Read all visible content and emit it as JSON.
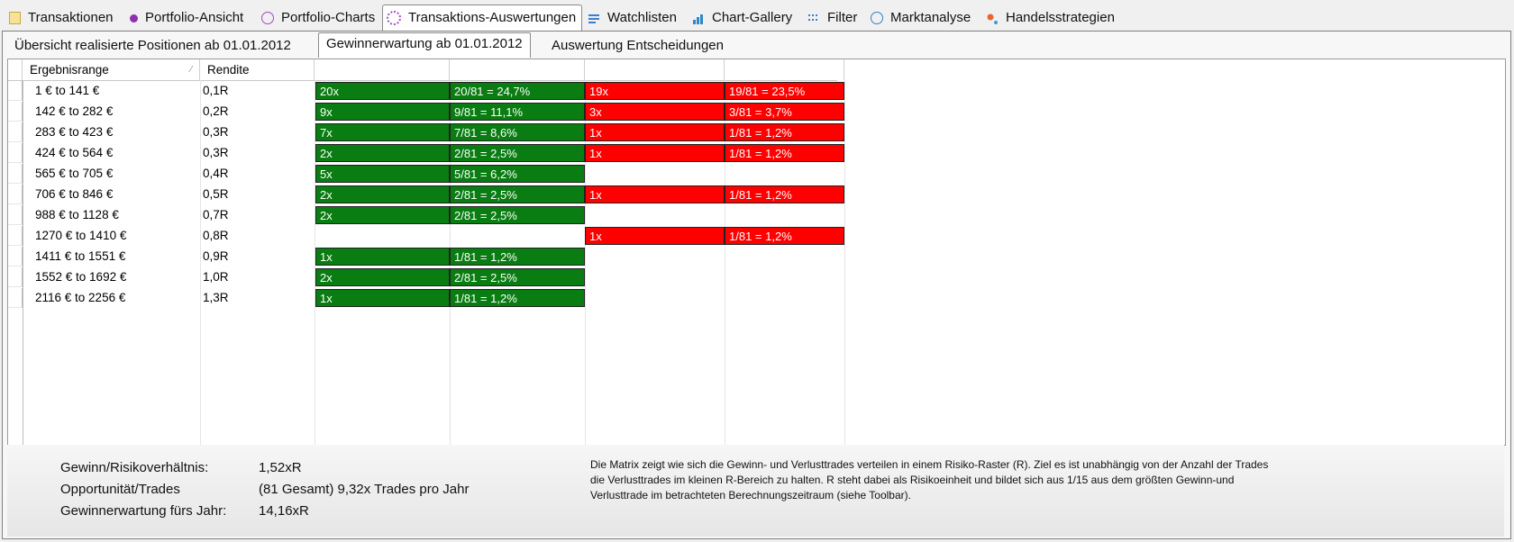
{
  "top_tabs": [
    {
      "label": "Transaktionen",
      "icon": "list-icon"
    },
    {
      "label": "Portfolio-Ansicht",
      "icon": "dot-icon"
    },
    {
      "label": "Portfolio-Charts",
      "icon": "circle-icon"
    },
    {
      "label": "Transaktions-Auswertungen",
      "icon": "dashed-circle-icon"
    },
    {
      "label": "Watchlisten",
      "icon": "watchlist-icon"
    },
    {
      "label": "Chart-Gallery",
      "icon": "chart-icon"
    },
    {
      "label": "Filter",
      "icon": "filter-icon"
    },
    {
      "label": "Marktanalyse",
      "icon": "compass-icon"
    },
    {
      "label": "Handelsstrategien",
      "icon": "strategy-icon"
    }
  ],
  "sub_tabs": [
    {
      "label": "Übersicht realisierte Positionen ab 01.01.2012"
    },
    {
      "label": "Gewinnerwartung ab 01.01.2012"
    },
    {
      "label": "Auswertung Entscheidungen"
    }
  ],
  "grid": {
    "col_range": "Ergebnisrange",
    "col_rendite": "Rendite",
    "rows": [
      {
        "range": "1 € to 141 €",
        "rendite": "0,1R",
        "win_count": "20x",
        "win_pct": "20/81 = 24,7%",
        "loss_count": "19x",
        "loss_pct": "19/81 = 23,5%"
      },
      {
        "range": "142 € to 282 €",
        "rendite": "0,2R",
        "win_count": "9x",
        "win_pct": "9/81 = 11,1%",
        "loss_count": "3x",
        "loss_pct": "3/81 = 3,7%"
      },
      {
        "range": "283 € to 423 €",
        "rendite": "0,3R",
        "win_count": "7x",
        "win_pct": "7/81 = 8,6%",
        "loss_count": "1x",
        "loss_pct": "1/81 = 1,2%"
      },
      {
        "range": "424 € to 564 €",
        "rendite": "0,3R",
        "win_count": "2x",
        "win_pct": "2/81 = 2,5%",
        "loss_count": "1x",
        "loss_pct": "1/81 = 1,2%"
      },
      {
        "range": "565 € to 705 €",
        "rendite": "0,4R",
        "win_count": "5x",
        "win_pct": "5/81 = 6,2%",
        "loss_count": "",
        "loss_pct": ""
      },
      {
        "range": "706 € to 846 €",
        "rendite": "0,5R",
        "win_count": "2x",
        "win_pct": "2/81 = 2,5%",
        "loss_count": "1x",
        "loss_pct": "1/81 = 1,2%"
      },
      {
        "range": "988 € to 1128 €",
        "rendite": "0,7R",
        "win_count": "2x",
        "win_pct": "2/81 = 2,5%",
        "loss_count": "",
        "loss_pct": ""
      },
      {
        "range": "1270 € to 1410 €",
        "rendite": "0,8R",
        "win_count": "",
        "win_pct": "",
        "loss_count": "1x",
        "loss_pct": "1/81 = 1,2%"
      },
      {
        "range": "1411 € to 1551 €",
        "rendite": "0,9R",
        "win_count": "1x",
        "win_pct": "1/81 = 1,2%",
        "loss_count": "",
        "loss_pct": ""
      },
      {
        "range": "1552 € to 1692 €",
        "rendite": "1,0R",
        "win_count": "2x",
        "win_pct": "2/81 = 2,5%",
        "loss_count": "",
        "loss_pct": ""
      },
      {
        "range": "2116 € to 2256 €",
        "rendite": "1,3R",
        "win_count": "1x",
        "win_pct": "1/81 = 1,2%",
        "loss_count": "",
        "loss_pct": ""
      }
    ]
  },
  "footer": {
    "gr_label": "Gewinn/Risikoverhältnis:",
    "gr_value": "1,52xR",
    "op_label": "Opportunität/Trades",
    "op_value": "(81 Gesamt) 9,32x Trades pro Jahr",
    "ge_label": "Gewinnerwartung fürs Jahr:",
    "ge_value": "14,16xR",
    "note": "Die Matrix zeigt wie sich die Gewinn- und Verlusttrades verteilen in einem Risiko-Raster (R). Ziel es ist unabhängig von der Anzahl der Trades die Verlusttrades im kleinen R-Bereich zu halten. R steht dabei als Risikoeinheit und bildet sich aus 1/15 aus dem größten Gewinn-und Verlusttrade im betrachteten Berechnungszeitraum (siehe Toolbar)."
  },
  "colors": {
    "win": "#0a7d12",
    "loss": "#ff0000"
  }
}
